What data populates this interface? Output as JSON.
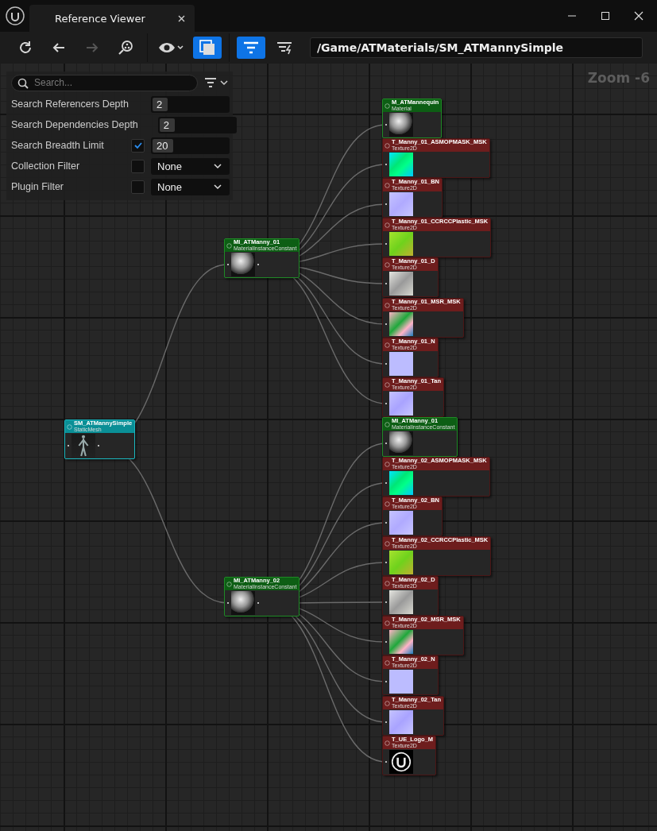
{
  "window": {
    "title": "Reference Viewer"
  },
  "toolbar": {
    "buttons": [
      {
        "kind": "refresh",
        "selected": false,
        "disabled": false
      },
      {
        "kind": "back",
        "selected": false,
        "disabled": false
      },
      {
        "kind": "forward",
        "selected": false,
        "disabled": true
      },
      {
        "kind": "find",
        "selected": false,
        "disabled": false
      },
      {
        "kind": "view",
        "selected": false,
        "disabled": false
      },
      {
        "kind": "duplicate",
        "selected": true,
        "disabled": false
      },
      {
        "kind": "filter",
        "selected": true,
        "disabled": false
      },
      {
        "kind": "filter_lightning",
        "selected": false,
        "disabled": false
      }
    ],
    "path": "/Game/ATMaterials/SM_ATMannySimple"
  },
  "settings": {
    "search": {
      "placeholder": "Search..."
    },
    "rows": [
      {
        "kind": "number",
        "label": "Search Referencers Depth",
        "value": "2"
      },
      {
        "kind": "number",
        "label": "Search Dependencies Depth",
        "value": "2"
      },
      {
        "kind": "number",
        "label": "Search Breadth Limit",
        "value": "20",
        "checked": true
      },
      {
        "kind": "dropdown",
        "label": "Collection Filter",
        "value": "None",
        "checked": false
      },
      {
        "kind": "dropdown",
        "label": "Plugin Filter",
        "value": "None",
        "checked": false
      }
    ]
  },
  "zoom_label": "Zoom -6",
  "graph": {
    "title": "SM_ATMannySimple",
    "subtitle": "StaticMesh",
    "kind": "mesh",
    "children": [
      {
        "title": "MI_ATManny_01",
        "subtitle": "MaterialInstanceConstant",
        "kind": "material",
        "children": [
          {
            "title": "M_ATMannequin",
            "subtitle": "Material",
            "kind": "material"
          },
          {
            "title": "T_Manny_01_ASMOPMASK_MSK",
            "subtitle": "Texture2D",
            "kind": "texture"
          },
          {
            "title": "T_Manny_01_BN",
            "subtitle": "Texture2D",
            "kind": "texture"
          },
          {
            "title": "T_Manny_01_CCRCCPIastic_MSK",
            "subtitle": "Texture2D",
            "kind": "texture"
          },
          {
            "title": "T_Manny_01_D",
            "subtitle": "Texture2D",
            "kind": "texture"
          },
          {
            "title": "T_Manny_01_MSR_MSK",
            "subtitle": "Texture2D",
            "kind": "texture"
          },
          {
            "title": "T_Manny_01_N",
            "subtitle": "Texture2D",
            "kind": "texture"
          },
          {
            "title": "T_Manny_01_Tan",
            "subtitle": "Texture2D",
            "kind": "texture"
          }
        ]
      },
      {
        "title": "MI_ATManny_02",
        "subtitle": "MaterialInstanceConstant",
        "kind": "material",
        "children": [
          {
            "title": "MI_ATManny_01",
            "subtitle": "MaterialInstanceConstant",
            "kind": "material"
          },
          {
            "title": "T_Manny_02_ASMOPMASK_MSK",
            "subtitle": "Texture2D",
            "kind": "texture"
          },
          {
            "title": "T_Manny_02_BN",
            "subtitle": "Texture2D",
            "kind": "texture"
          },
          {
            "title": "T_Manny_02_CCRCCPIastic_MSK",
            "subtitle": "Texture2D",
            "kind": "texture"
          },
          {
            "title": "T_Manny_02_D",
            "subtitle": "Texture2D",
            "kind": "texture"
          },
          {
            "title": "T_Manny_02_MSR_MSK",
            "subtitle": "Texture2D",
            "kind": "texture"
          },
          {
            "title": "T_Manny_02_N",
            "subtitle": "Texture2D",
            "kind": "texture"
          },
          {
            "title": "T_Manny_02_Tan",
            "subtitle": "Texture2D",
            "kind": "texture"
          },
          {
            "title": "T_UE_Logo_M",
            "subtitle": "Texture2D",
            "kind": "texture"
          }
        ]
      }
    ]
  }
}
